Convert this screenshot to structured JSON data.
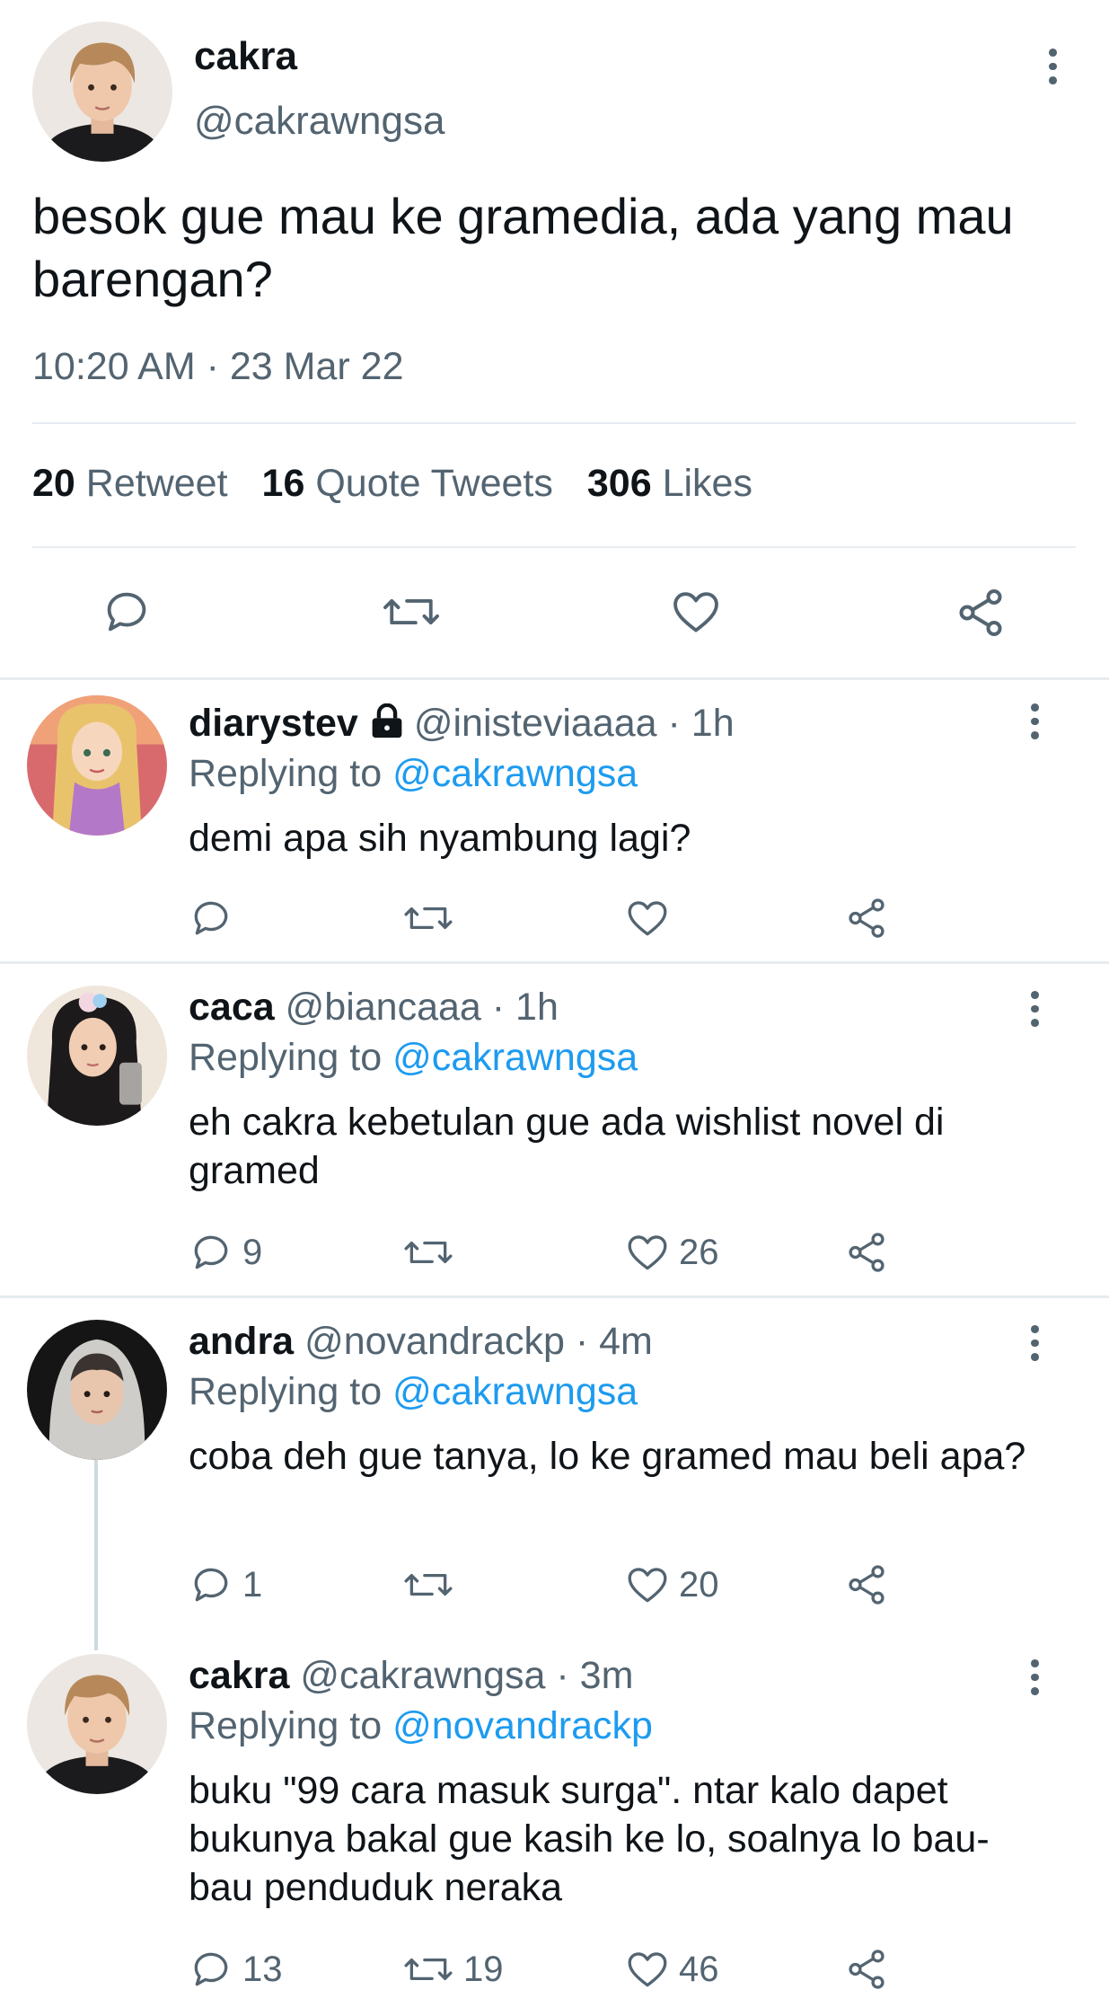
{
  "main_tweet": {
    "author_name": "cakra",
    "author_handle": "@cakrawngsa",
    "text": "besok gue mau ke gramedia, ada yang mau barengan?",
    "timestamp": "10:20 AM · 23 Mar 22",
    "stats": {
      "retweets_count": "20",
      "retweets_label": "Retweet",
      "quotes_count": "16",
      "quotes_label": "Quote Tweets",
      "likes_count": "306",
      "likes_label": "Likes"
    },
    "actions": [
      "reply",
      "retweet",
      "like",
      "share"
    ]
  },
  "replies": [
    {
      "name": "diarystev",
      "protected": true,
      "handle_time": "@inisteviaaaa · 1h",
      "replying_prefix": "Replying to ",
      "replying_to": "@cakrawngsa",
      "text": "demi apa sih nyambung lagi?",
      "reply_count": "",
      "retweet_count": "",
      "like_count": ""
    },
    {
      "name": "caca",
      "protected": false,
      "handle_time": "@biancaaa · 1h",
      "replying_prefix": "Replying to ",
      "replying_to": "@cakrawngsa",
      "text": "eh cakra kebetulan gue ada wishlist novel di gramed",
      "reply_count": "9",
      "retweet_count": "",
      "like_count": "26"
    },
    {
      "name": "andra",
      "protected": false,
      "handle_time": "@novandrackp · 4m",
      "replying_prefix": "Replying to ",
      "replying_to": "@cakrawngsa",
      "text": "coba deh gue tanya, lo ke gramed mau beli apa?",
      "reply_count": "1",
      "retweet_count": "",
      "like_count": "20"
    },
    {
      "name": "cakra",
      "protected": false,
      "handle_time": "@cakrawngsa · 3m",
      "replying_prefix": "Replying to ",
      "replying_to": "@novandrackp",
      "text": "buku \"99 cara masuk surga\". ntar kalo dapet bukunya bakal gue kasih ke lo, soalnya lo bau-bau penduduk neraka",
      "reply_count": "13",
      "retweet_count": "19",
      "like_count": "46"
    }
  ],
  "colors": {
    "text_primary": "#0f1419",
    "text_secondary": "#536471",
    "link": "#1d9bf0",
    "divider": "#e6ecf0"
  },
  "icons": [
    "more-vertical-icon",
    "reply-icon",
    "retweet-icon",
    "like-icon",
    "share-icon",
    "lock-icon"
  ]
}
